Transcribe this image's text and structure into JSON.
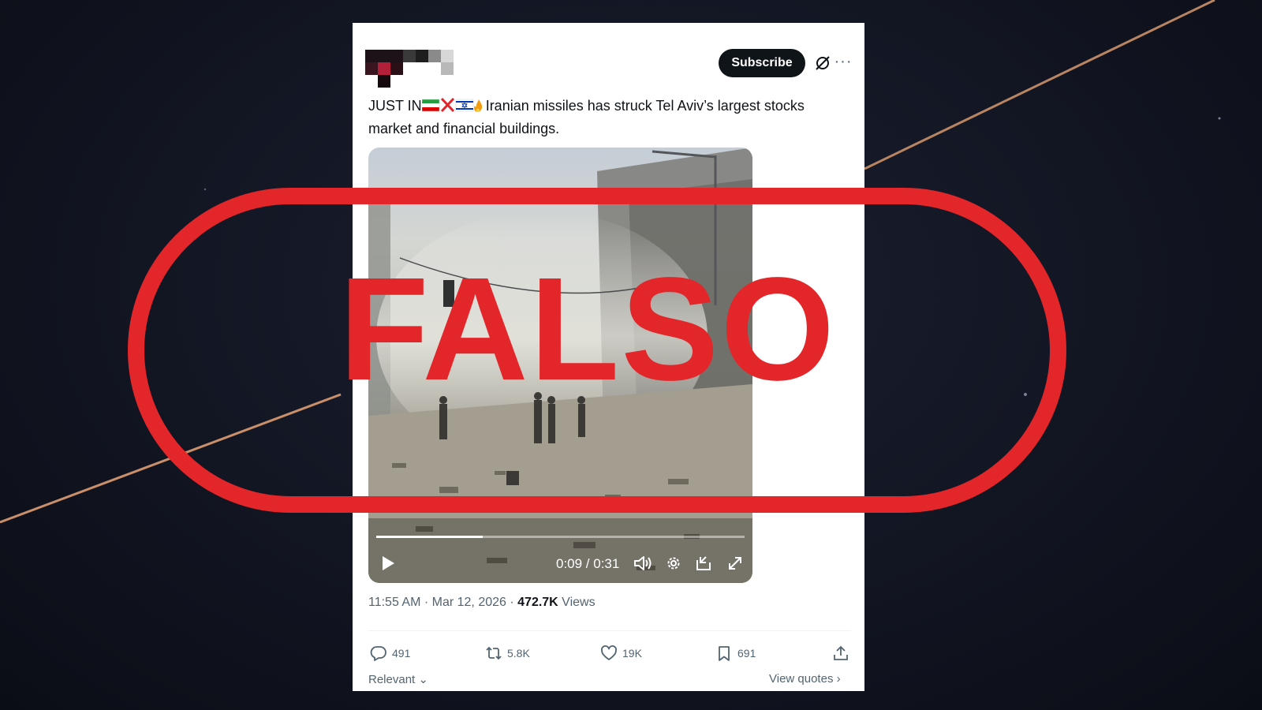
{
  "tweet": {
    "subscribe_label": "Subscribe",
    "more_label": "···",
    "text_prefix": "JUST IN",
    "text_body": " Iranian missiles has struck Tel Aviv’s largest stocks market and financial buildings.",
    "flag_emojis": [
      "iran-flag-icon",
      "cross-mark-icon",
      "israel-flag-icon",
      "fire-icon"
    ],
    "timestamp": "11:55 AM · Mar 12, 2026 · ",
    "views_count": "472.7K",
    "views_label": " Views",
    "sort_label": "Relevant",
    "view_quotes_label": "View quotes"
  },
  "video": {
    "time_label": "0:09 / 0:31",
    "progress": 0.29
  },
  "actions": {
    "replies": "491",
    "reposts": "5.8K",
    "likes": "19K",
    "bookmarks": "691"
  },
  "stamp": {
    "word": "FALSO",
    "color": "#e3262a"
  }
}
